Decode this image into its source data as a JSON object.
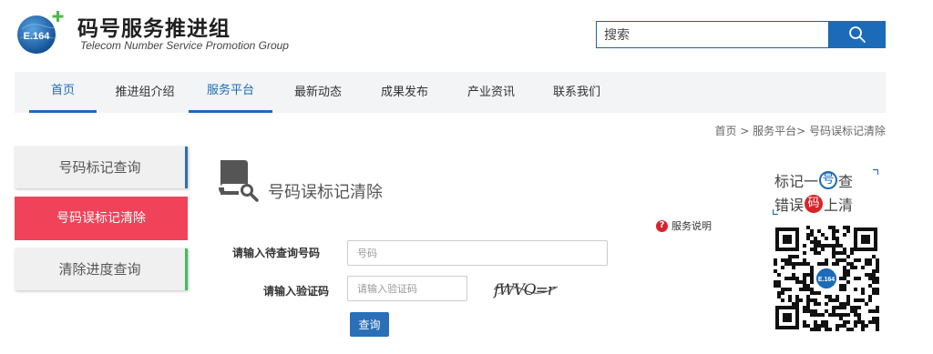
{
  "header": {
    "logo_text": "E.164",
    "brand_cn": "码号服务推进组",
    "brand_en": "Telecom Number Service  Promotion Group",
    "search_value": "搜索",
    "search_icon": "search-icon"
  },
  "nav": {
    "items": [
      {
        "label": "首页",
        "active": true
      },
      {
        "label": "推进组介绍",
        "active": false
      },
      {
        "label": "服务平台",
        "active": true
      },
      {
        "label": "最新动态",
        "active": false
      },
      {
        "label": "成果发布",
        "active": false
      },
      {
        "label": "产业资讯",
        "active": false
      },
      {
        "label": "联系我们",
        "active": false
      }
    ]
  },
  "breadcrumb": "首页 > 服务平台> 号码误标记清除",
  "sidebar": {
    "items": [
      {
        "label": "号码标记查询",
        "active": false
      },
      {
        "label": "号码误标记清除",
        "active": true
      },
      {
        "label": "清除进度查询",
        "active": false
      }
    ]
  },
  "main": {
    "title": "号码误标记清除",
    "help_label": "服务说明",
    "help_icon": "question-mark-icon",
    "number_label": "请输入待查询号码",
    "number_placeholder": "号码",
    "captcha_label": "请输入验证码",
    "captcha_placeholder": "请输入验证码",
    "captcha_text": "fWVO=r",
    "query_button": "查询"
  },
  "promo": {
    "line1_pre": "标记一",
    "line1_circle": "号",
    "line1_post": "查",
    "line2_pre": "错误",
    "line2_circle": "码",
    "line2_post": "上清",
    "qr_center_text": "E.164"
  },
  "colors": {
    "brand_blue": "#1b6bb8",
    "active_red": "#f0435a",
    "green_accent": "#3ebf5e",
    "nav_bg": "#f2f4f6"
  }
}
